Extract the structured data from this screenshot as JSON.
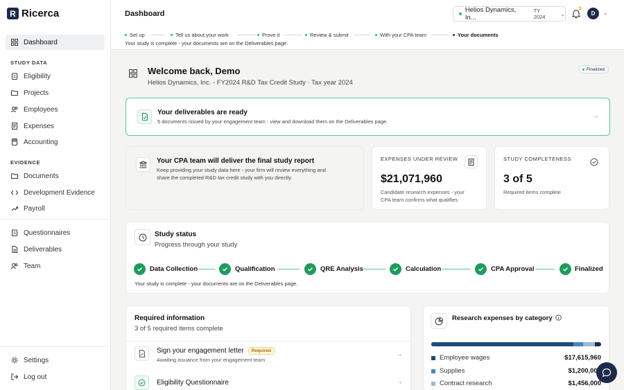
{
  "app": {
    "name": "Ricerca",
    "logo_letter": "R"
  },
  "sidebar": {
    "dashboard": "Dashboard",
    "section_study": "STUDY DATA",
    "study_items": [
      "Eligibility",
      "Projects",
      "Employees",
      "Expenses",
      "Accounting"
    ],
    "section_evidence": "EVIDENCE",
    "evidence_items": [
      "Documents",
      "Development Evidence",
      "Payroll"
    ],
    "other_items": [
      "Questionnaires",
      "Deliverables",
      "Team"
    ],
    "settings": "Settings",
    "logout": "Log out"
  },
  "topbar": {
    "title": "Dashboard",
    "company": "Helios Dynamics, In...",
    "tax_year": "TY 2024",
    "notification_count": "5",
    "avatar_initial": "D"
  },
  "progress_steps": {
    "steps": [
      "Set up",
      "Tell us about your work",
      "Prove it",
      "Review & submit",
      "With your CPA team",
      "Your documents"
    ],
    "note": "Your study is complete - your documents are on the Deliverables page."
  },
  "welcome": {
    "title": "Welcome back, Demo",
    "subtitle": "Helios Dynamics, Inc. - FY2024 R&D Tax Credit Study · Tax year 2024",
    "status": "Finalized"
  },
  "deliverables_banner": {
    "title": "Your deliverables are ready",
    "text": "5 documents issued by your engagement team - view and download them on the Deliverables page."
  },
  "cpa_card": {
    "title": "Your CPA team will deliver the final study report",
    "text_line1": "Keep providing your study data here - your firm will review everything and",
    "text_line2": "share the completed R&D tax credit study with you directly."
  },
  "expenses_card": {
    "label": "EXPENSES UNDER REVIEW",
    "value": "$21,071,960",
    "sub_line1": "Candidate research expenses - your",
    "sub_line2": "CPA team confirms what qualifies"
  },
  "completeness_card": {
    "label": "STUDY COMPLETENESS",
    "value": "3 of 5",
    "sub": "Required items complete"
  },
  "study_status": {
    "title": "Study status",
    "subtitle": "Progress through your study",
    "steps": [
      "Data Collection",
      "Qualification",
      "QRE Analysis",
      "Calculation",
      "CPA Approval",
      "Finalized"
    ],
    "note": "Your study is complete - your documents are on the Deliverables page."
  },
  "required_info": {
    "title": "Required information",
    "subtitle": "3 of 5 required items complete",
    "items": [
      {
        "title": "Sign your engagement letter",
        "tag": "Required",
        "sub": "Awaiting issuance from your engagement team"
      },
      {
        "title": "Eligibility Questionnaire"
      }
    ]
  },
  "research_expenses": {
    "title": "Research expenses by category",
    "categories": [
      {
        "name": "Employee wages",
        "value": "$17,615,960",
        "amount": 17615960,
        "color": "#1f4b7a"
      },
      {
        "name": "Supplies",
        "value": "$1,200,000",
        "amount": 1200000,
        "color": "#4a86c5"
      },
      {
        "name": "Contract research",
        "value": "$1,456,000",
        "amount": 1456000,
        "color": "#9db9d6"
      }
    ],
    "bar_end_color": "#1d2a4a"
  }
}
